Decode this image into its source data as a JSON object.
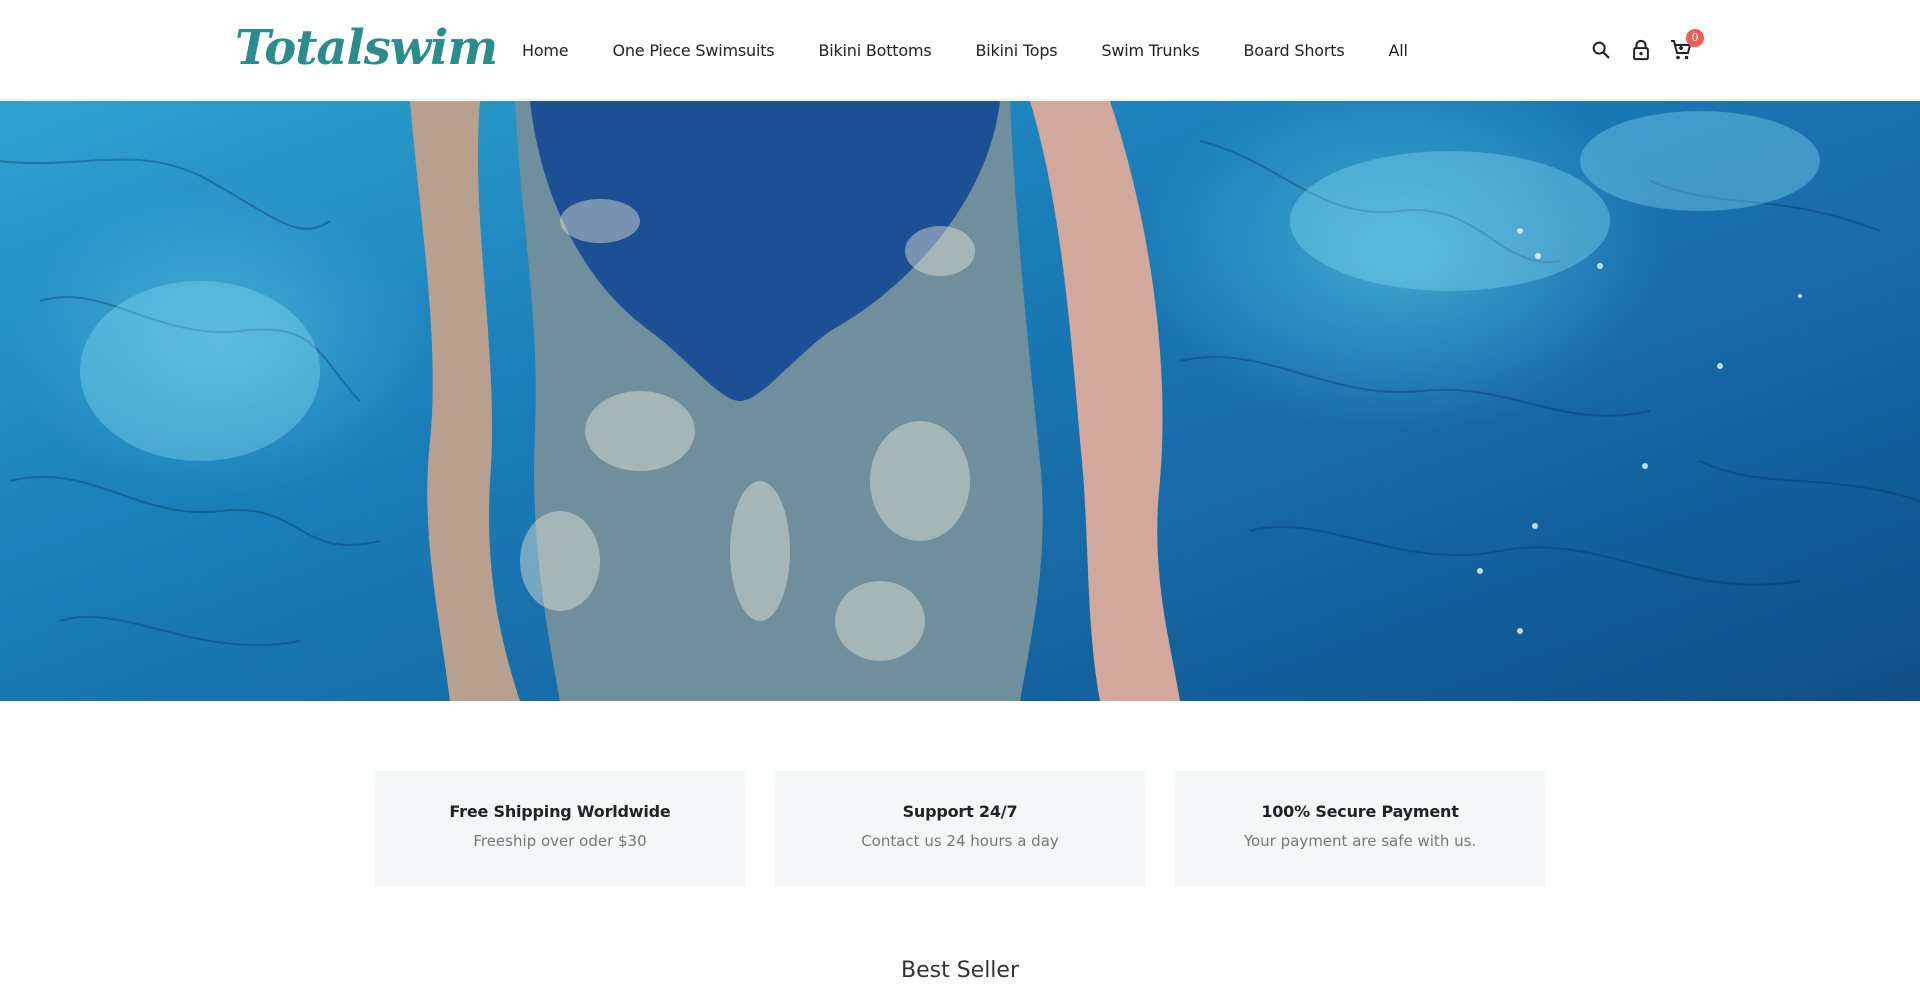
{
  "brand": {
    "logo_text": "Totalswim",
    "logo_color": "#2a8c8c"
  },
  "nav": {
    "items": [
      {
        "label": "Home"
      },
      {
        "label": "One Piece Swimsuits"
      },
      {
        "label": "Bikini Bottoms"
      },
      {
        "label": "Bikini Tops"
      },
      {
        "label": "Swim Trunks"
      },
      {
        "label": "Board Shorts"
      },
      {
        "label": "All"
      }
    ]
  },
  "header_icons": {
    "search": "search-icon",
    "account": "lock-icon",
    "cart": "cart-icon",
    "cart_count": "0",
    "badge_color": "#f25c54"
  },
  "hero": {
    "image": "swimmer-in-pool-photo"
  },
  "features": [
    {
      "title": "Free Shipping Worldwide",
      "subtitle": "Freeship over oder $30"
    },
    {
      "title": "Support 24/7",
      "subtitle": "Contact us 24 hours a day"
    },
    {
      "title": "100% Secure Payment",
      "subtitle": "Your payment are safe with us."
    }
  ],
  "sections": {
    "best_seller_title": "Best Seller"
  }
}
